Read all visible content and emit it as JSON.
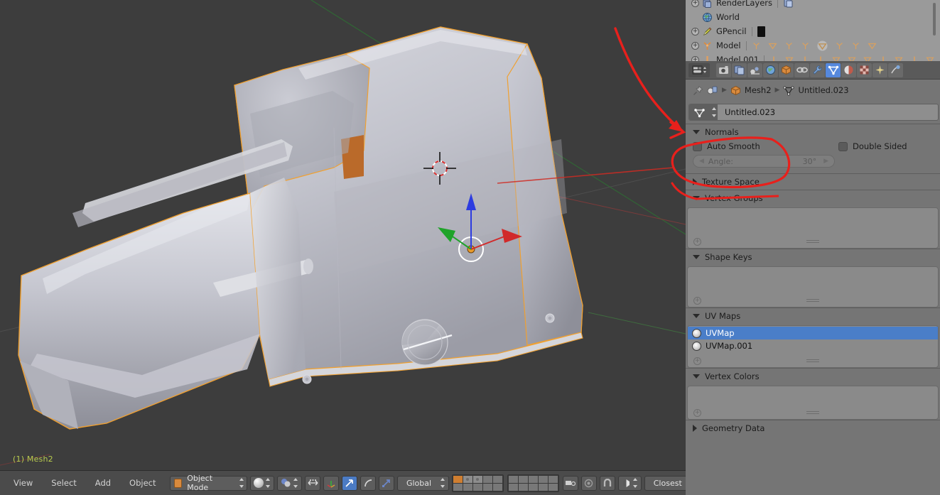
{
  "viewport": {
    "status_text": "(1) Mesh2",
    "background_color": "#3d3d3d",
    "selection_outline_color": "#f0a030",
    "grid_axis_y_color": "#2c6b2c",
    "model_description": "holographic-sight-mesh"
  },
  "viewport_header": {
    "menus": [
      "View",
      "Select",
      "Add",
      "Object"
    ],
    "mode": "Object Mode",
    "transform_orientation": "Global",
    "snap_target": "Closest",
    "icons": {
      "mode_cube": "cube-icon",
      "shading": "shading-sphere-icon",
      "pivot": "pivot-icon",
      "limit_visible": "limit-selection-icon",
      "manipulator_axis": "manipulator-axis-icon",
      "translate": "translate-manipulator-icon",
      "rotate": "rotate-manipulator-icon",
      "scale": "scale-manipulator-icon",
      "proportional": "proportional-edit-icon",
      "render_view": "render-view-icon",
      "render_animation": "render-animation-icon",
      "snap_magnet": "magnet-icon",
      "snap_element": "snap-element-icon",
      "overlay_only_render": "only-render-icon",
      "texture_solid": "texture-solid-icon"
    }
  },
  "outliner": {
    "rows": [
      {
        "label": "RenderLayers",
        "icon": "render-layers-icon",
        "expandable": true,
        "extra_icon": "render-layer-copy-icon"
      },
      {
        "label": "World",
        "icon": "world-icon",
        "expandable": false
      },
      {
        "label": "GPencil",
        "icon": "pencil-icon",
        "expandable": true,
        "extra_icon": "gpencil-swatch"
      },
      {
        "label": "Model",
        "icon": "armature-icon",
        "expandable": true,
        "children_icons": [
          "armature",
          "mesh",
          "armature",
          "armature",
          "mesh-active",
          "armature",
          "armature",
          "mesh"
        ]
      },
      {
        "label": "Model.001",
        "icon": "bone-icon",
        "expandable": true,
        "children_icons": [
          "bone",
          "mesh",
          "bone",
          "bone",
          "mesh",
          "mesh",
          "mesh",
          "bone",
          "mesh",
          "bone",
          "mesh"
        ]
      }
    ]
  },
  "properties": {
    "tabs": [
      {
        "name": "editor-type",
        "icon": "editor-type-icon",
        "selected": false
      },
      {
        "name": "render",
        "icon": "camera-icon",
        "selected": false
      },
      {
        "name": "render-layers",
        "icon": "images-icon",
        "selected": false
      },
      {
        "name": "scene",
        "icon": "scene-icon",
        "selected": false
      },
      {
        "name": "world",
        "icon": "world-globe-icon",
        "selected": false
      },
      {
        "name": "object",
        "icon": "cube-icon",
        "selected": false
      },
      {
        "name": "constraints",
        "icon": "chain-icon",
        "selected": false
      },
      {
        "name": "modifiers",
        "icon": "wrench-icon",
        "selected": false
      },
      {
        "name": "object-data",
        "icon": "mesh-data-icon",
        "selected": true
      },
      {
        "name": "material",
        "icon": "material-sphere-icon",
        "selected": false
      },
      {
        "name": "texture",
        "icon": "checker-icon",
        "selected": false
      },
      {
        "name": "particles",
        "icon": "particles-icon",
        "selected": false
      },
      {
        "name": "physics",
        "icon": "physics-icon",
        "selected": false
      }
    ],
    "breadcrumb": {
      "pin_icon": "pin-icon",
      "editor_icon": "properties-editor-icon",
      "object_name": "Mesh2",
      "data_name": "Untitled.023"
    },
    "name_field": {
      "icon": "mesh-data-icon",
      "value": "Untitled.023"
    },
    "panels": [
      {
        "id": "normals",
        "title": "Normals",
        "open": true,
        "auto_smooth_label": "Auto Smooth",
        "auto_smooth_checked": false,
        "double_sided_label": "Double Sided",
        "double_sided_checked": false,
        "angle_label": "Angle:",
        "angle_value": "30°"
      },
      {
        "id": "texture_space",
        "title": "Texture Space",
        "open": false
      },
      {
        "id": "vertex_groups",
        "title": "Vertex Groups",
        "open": true,
        "items": []
      },
      {
        "id": "shape_keys",
        "title": "Shape Keys",
        "open": true,
        "items": []
      },
      {
        "id": "uv_maps",
        "title": "UV Maps",
        "open": true,
        "items": [
          {
            "label": "UVMap",
            "selected": true
          },
          {
            "label": "UVMap.001",
            "selected": false
          }
        ]
      },
      {
        "id": "vertex_colors",
        "title": "Vertex Colors",
        "open": true,
        "items": []
      },
      {
        "id": "geometry_data",
        "title": "Geometry Data",
        "open": false
      }
    ]
  },
  "annotations": {
    "color": "#e8201c",
    "shapes": [
      "curved-arrow-to-normals-panel",
      "ellipse-around-auto-smooth-and-angle"
    ]
  }
}
